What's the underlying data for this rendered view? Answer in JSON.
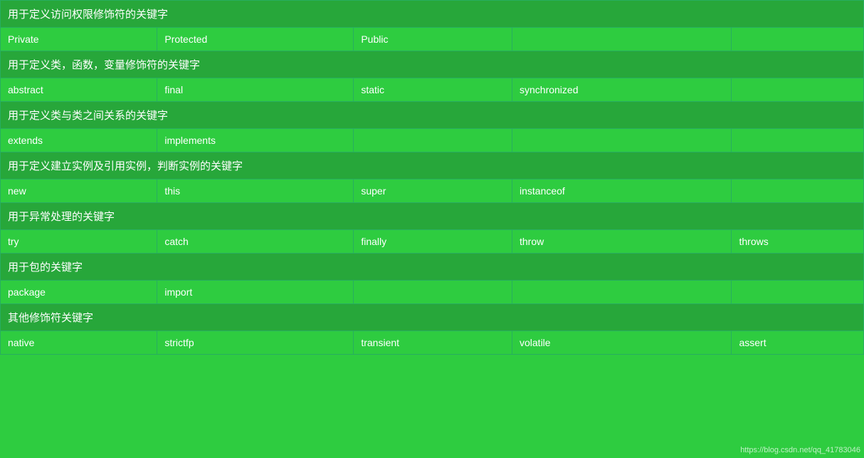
{
  "title": "用于定义访问权限修饰符的关键字",
  "watermark": "https://blog.csdn.net/qq_41783046",
  "sections": [
    {
      "type": "header",
      "label": "用于定义访问权限修饰符的关键字",
      "colspan": 5
    },
    {
      "type": "data",
      "cells": [
        "Private",
        "Protected",
        "Public",
        "",
        ""
      ]
    },
    {
      "type": "header",
      "label": "用于定义类，函数，变量修饰符的关键字",
      "colspan": 5
    },
    {
      "type": "data",
      "cells": [
        "abstract",
        "final",
        "static",
        "synchronized",
        ""
      ]
    },
    {
      "type": "header",
      "label": "用于定义类与类之间关系的关键字",
      "colspan": 5
    },
    {
      "type": "data",
      "cells": [
        "extends",
        "implements",
        "",
        "",
        ""
      ]
    },
    {
      "type": "header",
      "label": "用于定义建立实例及引用实例，判断实例的关键字",
      "colspan": 5
    },
    {
      "type": "data",
      "cells": [
        "new",
        "this",
        "super",
        "instanceof",
        ""
      ]
    },
    {
      "type": "header",
      "label": "用于异常处理的关键字",
      "colspan": 5
    },
    {
      "type": "data",
      "cells": [
        "try",
        "catch",
        "finally",
        "throw",
        "throws"
      ]
    },
    {
      "type": "header",
      "label": "用于包的关键字",
      "colspan": 5
    },
    {
      "type": "data",
      "cells": [
        "package",
        "import",
        "",
        "",
        ""
      ]
    },
    {
      "type": "header",
      "label": "其他修饰符关键字",
      "colspan": 5
    },
    {
      "type": "data",
      "cells": [
        "native",
        "strictfp",
        "transient",
        "volatile",
        "assert"
      ]
    }
  ]
}
